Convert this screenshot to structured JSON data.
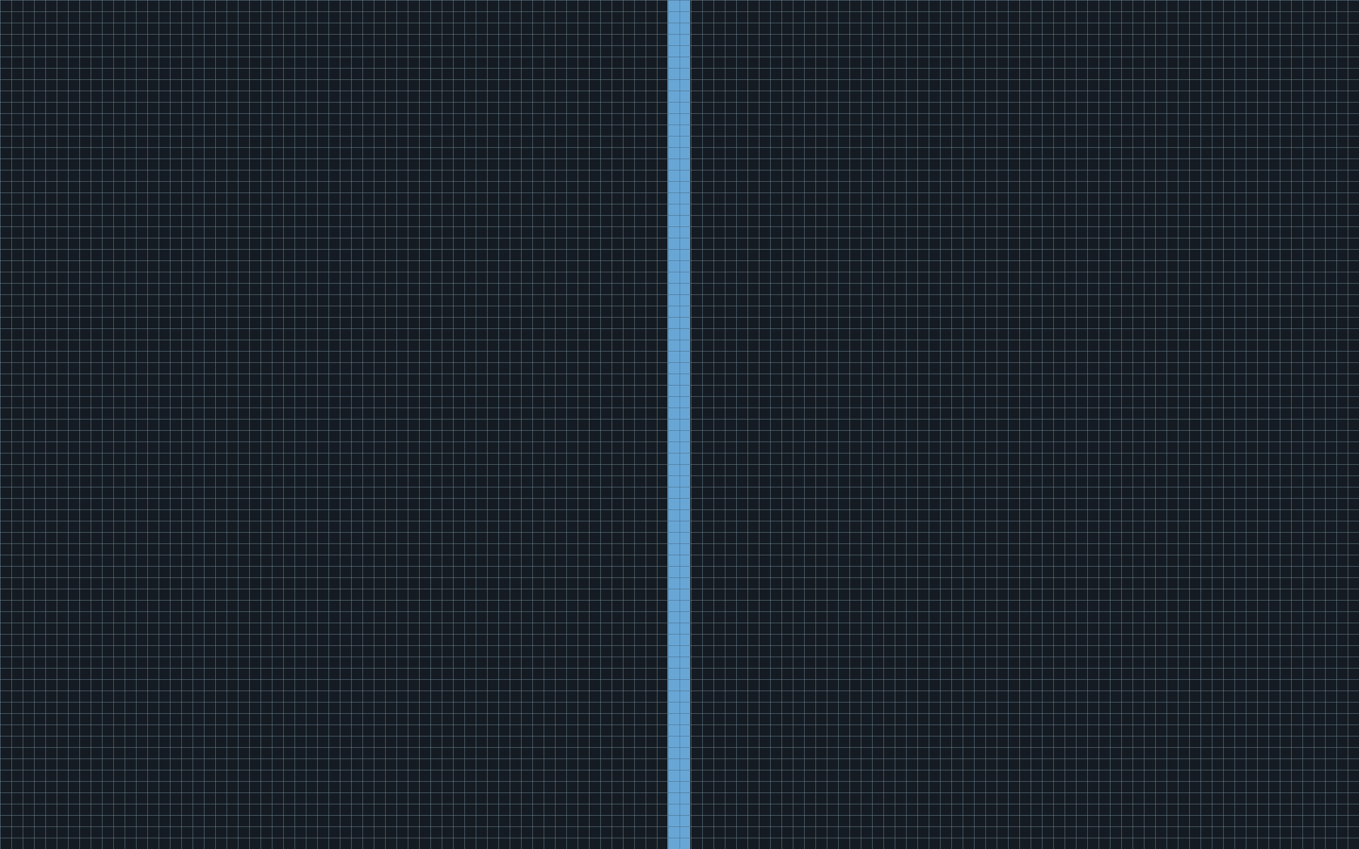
{
  "canvas": {
    "background_color": "#151b22",
    "grid_line_color": "#6e8796",
    "divider_color": "#68a6d6",
    "grid_visible": true
  }
}
